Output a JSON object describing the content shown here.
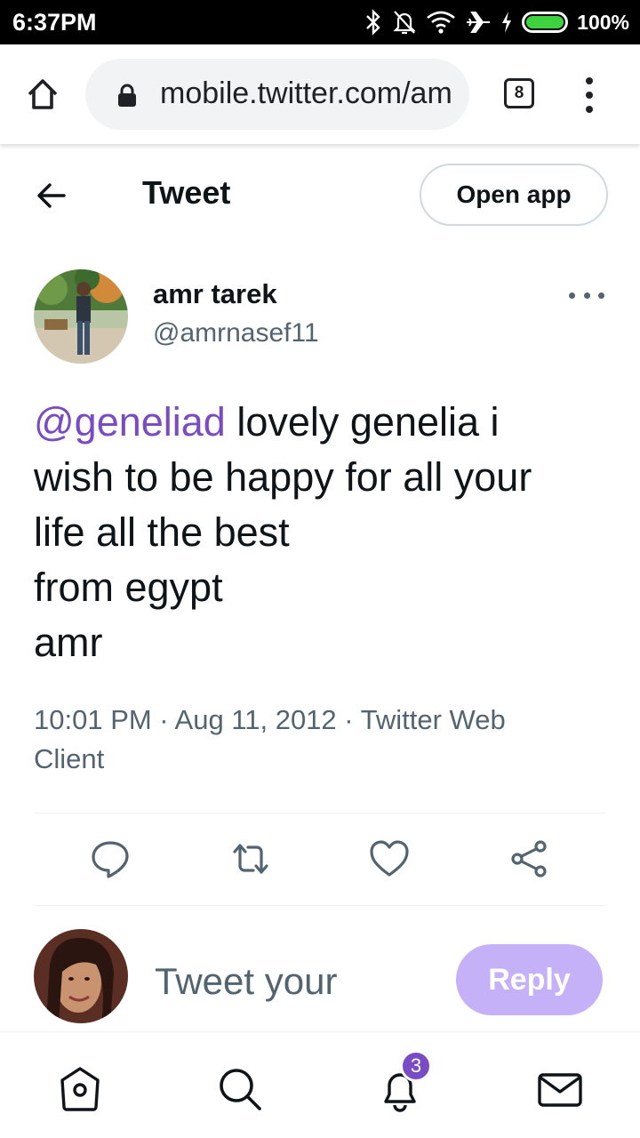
{
  "status_bar": {
    "time": "6:37PM",
    "battery_percent": "100%",
    "battery_level": 1.0,
    "battery_color": "#3ed23e",
    "icons": [
      "bluetooth-icon",
      "bell-off-icon",
      "wifi-icon",
      "airplane-icon",
      "charging-icon",
      "battery-icon"
    ]
  },
  "browser": {
    "url": "mobile.twitter.com/amr",
    "tab_count": "8",
    "icons": [
      "home-icon",
      "lock-icon",
      "menu-dots-icon"
    ]
  },
  "header": {
    "title": "Tweet",
    "open_app_label": "Open app"
  },
  "tweet": {
    "author_name": "amr tarek",
    "author_handle": "@amrnasef11",
    "mention": "@geneliad",
    "line1_rest": " lovely genelia i",
    "line2": "wish to be happy for all your",
    "line3": "life all the best",
    "line4": "from egypt",
    "line5": "amr",
    "meta_line1": "10:01 PM · Aug 11, 2012 · Twitter Web",
    "meta_line2": "Client",
    "mention_color": "#794bc4"
  },
  "actions": [
    "reply-icon",
    "retweet-icon",
    "like-icon",
    "share-icon"
  ],
  "reply_box": {
    "placeholder": "Tweet your",
    "button_label": "Reply",
    "button_color": "#c4b1f7"
  },
  "bottom_nav": {
    "items": [
      "home-icon",
      "search-icon",
      "notifications-icon",
      "messages-icon"
    ],
    "notification_count": "3",
    "badge_color": "#794bc4"
  }
}
